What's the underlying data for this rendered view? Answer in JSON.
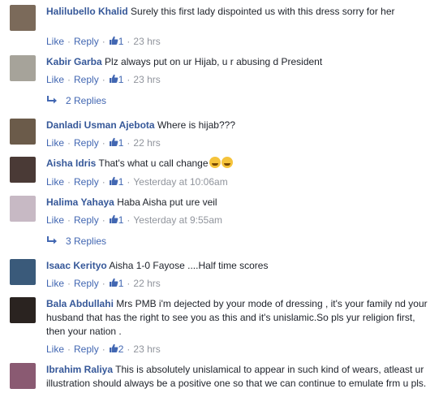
{
  "actions": {
    "like": "Like",
    "reply": "Reply",
    "dot": "·"
  },
  "comments": [
    {
      "author": "Halilubello Khalid",
      "text": "Surely this first lady dispointed us with this dress sorry for her",
      "likes": "1",
      "time": "23 hrs",
      "avatar_color": "#7b6a5a"
    },
    {
      "author": "Kabir Garba",
      "text": "Plz always put on ur Hijab, u r abusing d President",
      "likes": "1",
      "time": "23 hrs",
      "avatar_color": "#a6a39a",
      "replies": "2 Replies"
    },
    {
      "author": "Danladi Usman Ajebota",
      "text": "Where is hijab???",
      "likes": "1",
      "time": "22 hrs",
      "avatar_color": "#6b5b4a"
    },
    {
      "author": "Aisha Idris",
      "text": "That's what u call change",
      "likes": "1",
      "time": "Yesterday at 10:06am",
      "avatar_color": "#4a3a36"
    },
    {
      "author": "Halima Yahaya",
      "text": "Haba Aisha put ure veil",
      "likes": "1",
      "time": "Yesterday at 9:55am",
      "avatar_color": "#c7b9c4",
      "replies": "3 Replies"
    },
    {
      "author": "Isaac Kerityo",
      "text": "Aisha 1-0 Fayose ....Half time scores",
      "likes": "1",
      "time": "22 hrs",
      "avatar_color": "#3a5a7a"
    },
    {
      "author": "Bala Abdullahi",
      "text": "Mrs PMB i'm dejected by your mode of dressing , it's your family nd your husband that has the right to see you as this and it's unislamic.So pls yur religion first, then your nation .",
      "likes": "2",
      "time": "23 hrs",
      "avatar_color": "#2a2320"
    },
    {
      "author": "Ibrahim Raliya",
      "text": "This is absolutely unislamical to appear in such kind of wears, atleast ur illustration should always be a positive one so that we can continue to emulate frm u pls.",
      "avatar_color": "#8a5a72"
    }
  ]
}
